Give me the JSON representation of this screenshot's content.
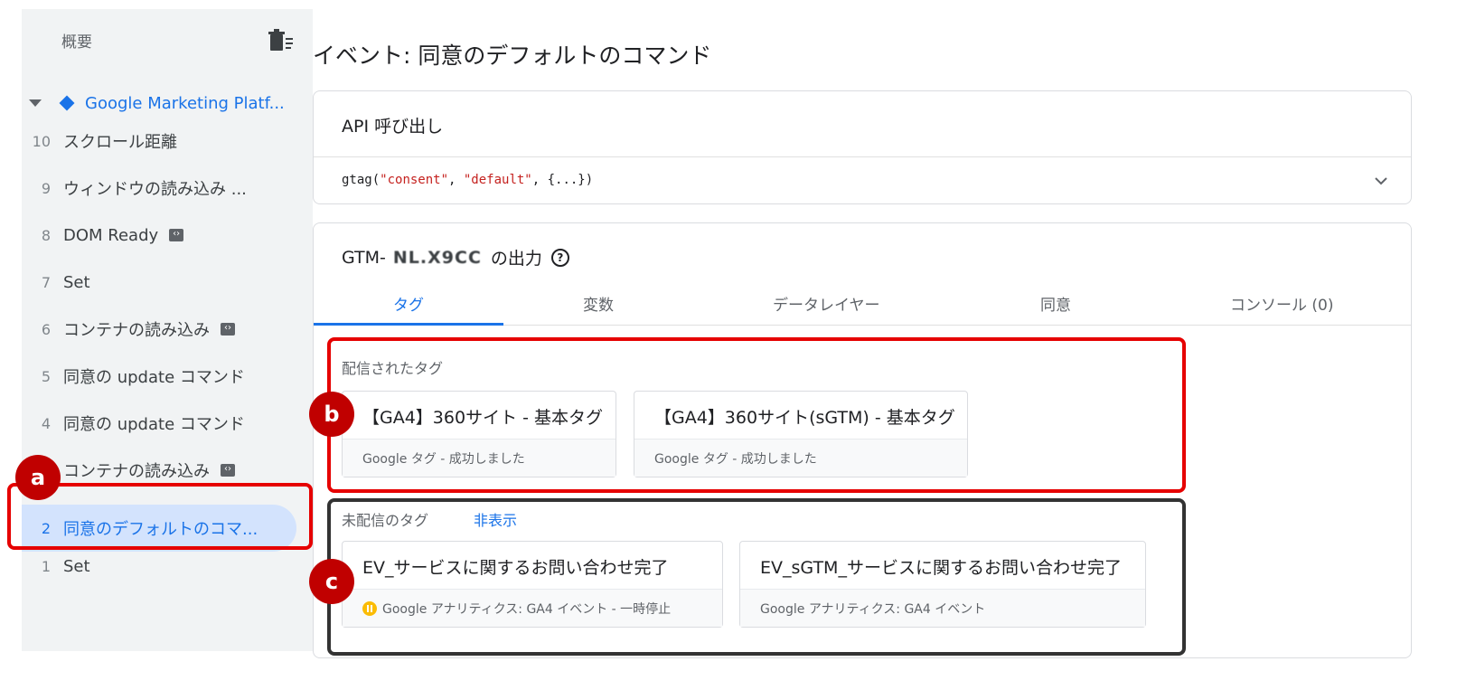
{
  "sidebar": {
    "header": "概要",
    "root_item": "Google Marketing Platf...",
    "items": [
      {
        "num": "10",
        "label": "スクロール距離"
      },
      {
        "num": "9",
        "label": "ウィンドウの読み込み ..."
      },
      {
        "num": "8",
        "label": "DOM Ready"
      },
      {
        "num": "7",
        "label": "Set"
      },
      {
        "num": "6",
        "label": "コンテナの読み込み"
      },
      {
        "num": "5",
        "label": "同意の update コマンド"
      },
      {
        "num": "4",
        "label": "同意の update コマンド"
      },
      {
        "num": "3",
        "label": "コンテナの読み込み"
      },
      {
        "num": "2",
        "label": "同意のデフォルトのコマ..."
      },
      {
        "num": "1",
        "label": "Set"
      }
    ]
  },
  "main": {
    "title": "イベント: 同意のデフォルトのコマンド",
    "api": {
      "title": "API 呼び出し",
      "code_prefix": "gtag(",
      "code_arg1": "\"consent\"",
      "code_sep1": ", ",
      "code_arg2": "\"default\"",
      "code_suffix": ", {...})"
    },
    "output": {
      "title_prefix": "GTM-",
      "container_id": "NL.X9CC",
      "title_suffix": "の出力",
      "tabs": [
        "タグ",
        "変数",
        "データレイヤー",
        "同意",
        "コンソール (0)"
      ]
    },
    "fired": {
      "label": "配信されたタグ",
      "tags": [
        {
          "name": "【GA4】360サイト - 基本タグ",
          "status": "Google タグ - 成功しました"
        },
        {
          "name": "【GA4】360サイト(sGTM) - 基本タグ",
          "status": "Google タグ - 成功しました"
        }
      ]
    },
    "not_fired": {
      "label": "未配信のタグ",
      "hide_link": "非表示",
      "tags": [
        {
          "name": "EV_サービスに関するお問い合わせ完了",
          "status": "Google アナリティクス: GA4 イベント - 一時停止"
        },
        {
          "name": "EV_sGTM_サービスに関するお問い合わせ完了",
          "status": "Google アナリティクス: GA4 イベント"
        }
      ]
    }
  },
  "annotations": {
    "a": "a",
    "b": "b",
    "c": "c"
  },
  "colors": {
    "accent": "#1a73e8",
    "highlight_red": "#e60000",
    "marker_red": "#c00000",
    "selected_bg": "#d3e3fd"
  }
}
